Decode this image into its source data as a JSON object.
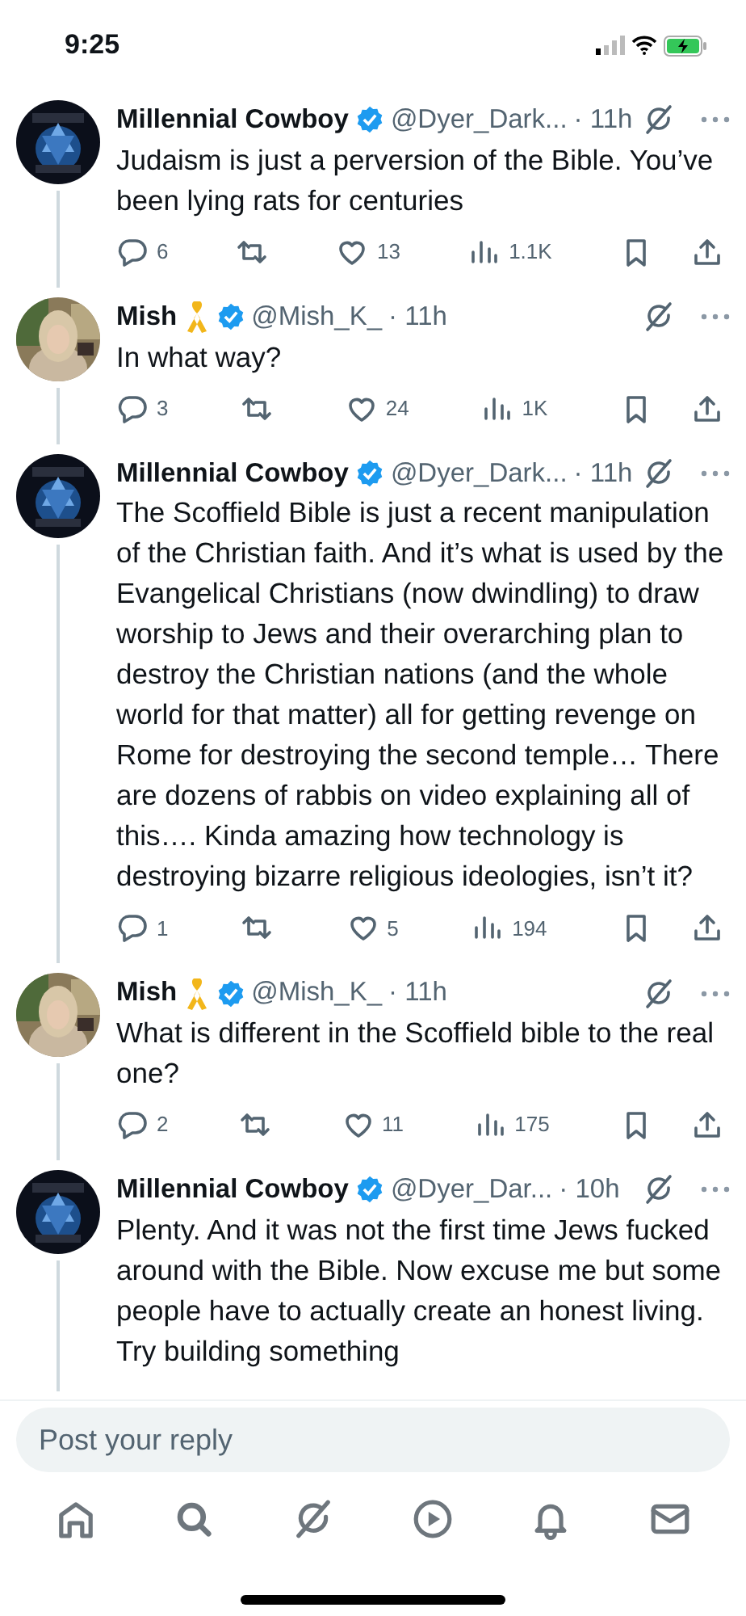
{
  "status_bar": {
    "time": "9:25"
  },
  "tweets": [
    {
      "name": "Millennial Cowboy",
      "ribbon": false,
      "verified": true,
      "handle": "@Dyer_Dark...",
      "time": "· 11h",
      "text": "Judaism is just a perversion of the Bible. You’ve been lying rats for centuries",
      "replies": "6",
      "likes": "13",
      "views": "1.1K"
    },
    {
      "name": "Mish",
      "ribbon": true,
      "verified": true,
      "handle": "@Mish_K_",
      "time": "· 11h",
      "text": "In what way?",
      "replies": "3",
      "likes": "24",
      "views": "1K"
    },
    {
      "name": "Millennial Cowboy",
      "ribbon": false,
      "verified": true,
      "handle": "@Dyer_Dark...",
      "time": "· 11h",
      "text": "The Scoffield Bible is just a recent manipulation of the Christian faith. And it’s what is used by the Evangelical Christians (now dwindling) to draw worship to Jews and their overarching plan to destroy the Christian nations (and the whole world for that matter) all for getting revenge on Rome for destroying the second temple… There are dozens of rabbis on video explaining all of this…. Kinda amazing how technology is destroying bizarre religious ideologies, isn’t it?",
      "replies": "1",
      "likes": "5",
      "views": "194"
    },
    {
      "name": "Mish",
      "ribbon": true,
      "verified": true,
      "handle": "@Mish_K_",
      "time": "· 11h",
      "text": "What is different in the Scoffield bible to the real one?",
      "replies": "2",
      "likes": "11",
      "views": "175"
    },
    {
      "name": "Millennial Cowboy",
      "ribbon": false,
      "verified": true,
      "handle": "@Dyer_Dar...",
      "time": "· 10h",
      "text": "Plenty. And it was not the first time Jews fucked around with the Bible. Now excuse me but some people have to actually create an honest living. Try building something"
    }
  ],
  "reply_box": {
    "placeholder": "Post your reply"
  }
}
